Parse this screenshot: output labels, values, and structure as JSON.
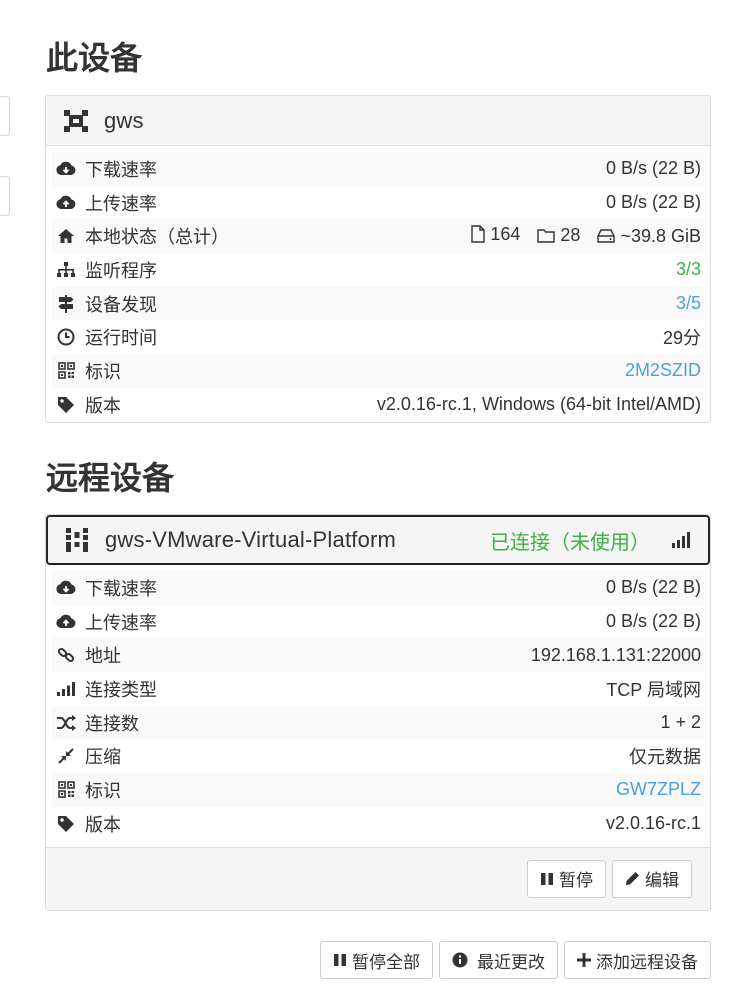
{
  "this_device": {
    "section_title": "此设备",
    "name": "gws",
    "rows": {
      "download": {
        "label": "下载速率",
        "value": "0 B/s (22 B)"
      },
      "upload": {
        "label": "上传速率",
        "value": "0 B/s (22 B)"
      },
      "local_state": {
        "label": "本地状态（总计）",
        "files": "164",
        "folders": "28",
        "size": "~39.8 GiB"
      },
      "listeners": {
        "label": "监听程序",
        "value": "3/3"
      },
      "discovery": {
        "label": "设备发现",
        "value": "3/5"
      },
      "uptime": {
        "label": "运行时间",
        "value": "29分"
      },
      "id": {
        "label": "标识",
        "value": "2M2SZID"
      },
      "version": {
        "label": "版本",
        "value": "v2.0.16-rc.1, Windows (64-bit Intel/AMD)"
      }
    }
  },
  "remote_devices": {
    "section_title": "远程设备",
    "device": {
      "name": "gws-VMware-Virtual-Platform",
      "status": "已连接（未使用）",
      "rows": {
        "download": {
          "label": "下载速率",
          "value": "0 B/s (22 B)"
        },
        "upload": {
          "label": "上传速率",
          "value": "0 B/s (22 B)"
        },
        "address": {
          "label": "地址",
          "value": "192.168.1.131:22000"
        },
        "conn_type": {
          "label": "连接类型",
          "value": "TCP 局域网"
        },
        "conn_count": {
          "label": "连接数",
          "value": "1 + 2"
        },
        "compression": {
          "label": "压缩",
          "value": "仅元数据"
        },
        "id": {
          "label": "标识",
          "value": "GW7ZPLZ"
        },
        "version": {
          "label": "版本",
          "value": "v2.0.16-rc.1"
        }
      },
      "buttons": {
        "pause": "暂停",
        "edit": "编辑"
      }
    }
  },
  "bottom_buttons": {
    "pause_all": "暂停全部",
    "recent_changes": "最近更改",
    "add_remote": "添加远程设备"
  },
  "colors": {
    "link": "#4aa0d8",
    "ok": "#3cb043",
    "text": "#333333"
  },
  "icons": [
    "desktop-qr-icon",
    "cloud-download-icon",
    "cloud-upload-icon",
    "home-icon",
    "file-icon",
    "folder-icon",
    "hdd-icon",
    "sitemap-icon",
    "signpost-icon",
    "clock-icon",
    "qrcode-icon",
    "tag-icon",
    "signal-icon",
    "link-icon",
    "shuffle-icon",
    "compress-icon",
    "pause-icon",
    "pencil-icon",
    "info-icon",
    "plus-icon"
  ]
}
